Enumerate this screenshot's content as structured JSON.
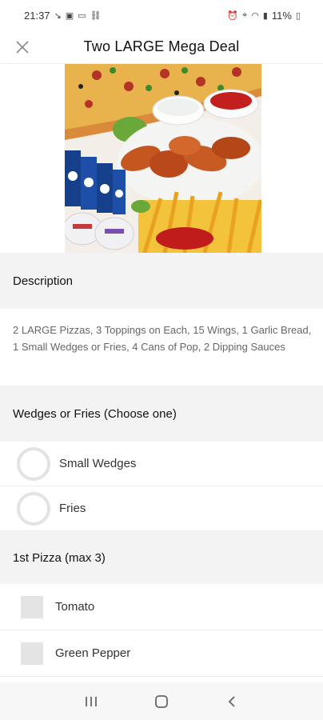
{
  "status": {
    "time": "21:37",
    "battery": "11%"
  },
  "header": {
    "title": "Two LARGE Mega Deal"
  },
  "description": {
    "heading": "Description",
    "text": "2 LARGE Pizzas, 3 Toppings on Each, 15 Wings, 1 Garlic Bread, 1 Small Wedges or Fries, 4 Cans of Pop, 2 Dipping Sauces"
  },
  "wedges_group": {
    "heading": "Wedges or Fries (Choose one)",
    "options": [
      {
        "label": "Small Wedges"
      },
      {
        "label": "Fries"
      }
    ]
  },
  "pizza_group": {
    "heading": "1st Pizza (max 3)",
    "options": [
      {
        "label": "Tomato"
      },
      {
        "label": "Green Pepper"
      }
    ]
  },
  "colors": {
    "section_bg": "#f3f3f3",
    "radio_border": "#e3e3e3",
    "checkbox_bg": "#e4e4e4"
  }
}
